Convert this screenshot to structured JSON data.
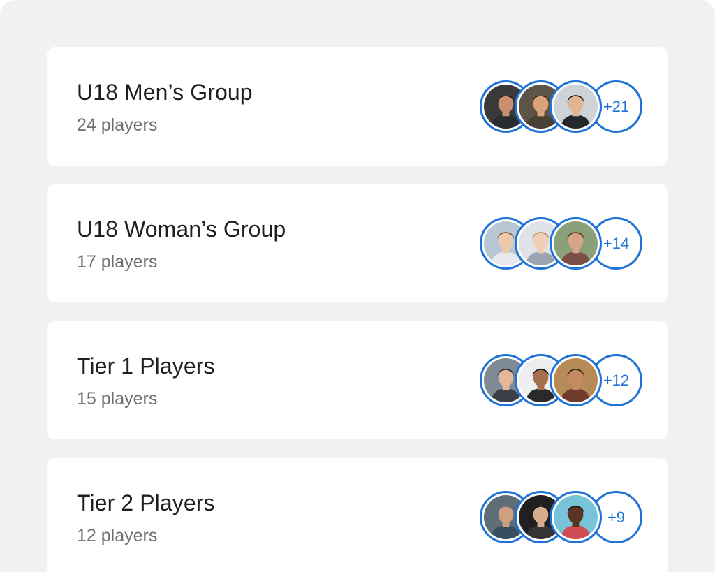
{
  "groups": [
    {
      "title": "U18 Men’s Group",
      "subtitle": "24 players",
      "more": "+21",
      "avatars": [
        {
          "bg": "#3a3a3c",
          "skin": "#c98e6b",
          "hair": "#1b1614",
          "shirt": "#2a2c33"
        },
        {
          "bg": "#5d5347",
          "skin": "#d9a47c",
          "hair": "#3a2a1d",
          "shirt": "#4a4136"
        },
        {
          "bg": "#cfd3d8",
          "skin": "#e0b596",
          "hair": "#1d1a18",
          "shirt": "#25272b"
        }
      ]
    },
    {
      "title": "U18 Woman’s Group",
      "subtitle": "17 players",
      "more": "+14",
      "avatars": [
        {
          "bg": "#b9c7d4",
          "skin": "#edc9ad",
          "hair": "#7a5236",
          "shirt": "#e7e9ec"
        },
        {
          "bg": "#dfe2e6",
          "skin": "#f0cfb8",
          "hair": "#b48a63",
          "shirt": "#9ba5b0"
        },
        {
          "bg": "#8aa07a",
          "skin": "#d8a486",
          "hair": "#4a2e22",
          "shirt": "#7a4d45"
        }
      ]
    },
    {
      "title": "Tier 1 Players",
      "subtitle": "15 players",
      "more": "+12",
      "avatars": [
        {
          "bg": "#7d8a96",
          "skin": "#e2b79a",
          "hair": "#2d2622",
          "shirt": "#3a3f48"
        },
        {
          "bg": "#eceef0",
          "skin": "#a66f4c",
          "hair": "#141414",
          "shirt": "#2a2a2a"
        },
        {
          "bg": "#b78b57",
          "skin": "#c68a62",
          "hair": "#3a2517",
          "shirt": "#6f3b2c"
        }
      ]
    },
    {
      "title": "Tier 2 Players",
      "subtitle": "12 players",
      "more": "+9",
      "avatars": [
        {
          "bg": "#5e6e76",
          "skin": "#cf9f82",
          "hair": "#6a6f75",
          "shirt": "#36505f"
        },
        {
          "bg": "#202020",
          "skin": "#d9ab8e",
          "hair": "#141414",
          "shirt": "#353535"
        },
        {
          "bg": "#79c3d9",
          "skin": "#5a3322",
          "hair": "#1a1210",
          "shirt": "#d14b52"
        }
      ]
    }
  ],
  "colors": {
    "accent": "#1f72d6",
    "page_background": "#f0f1f3",
    "card_background": "#ffffff",
    "title_text": "#1e1f22",
    "subtitle_text": "#6d6f74"
  }
}
